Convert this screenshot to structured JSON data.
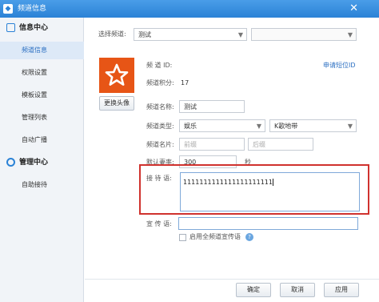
{
  "window": {
    "title": "频道信息",
    "close_glyph": "✕"
  },
  "sidebar": {
    "section1": {
      "label": "信息中心",
      "icon": "document-icon"
    },
    "section1_items": [
      {
        "label": "频道信息",
        "active": true
      },
      {
        "label": "权限设置",
        "active": false
      },
      {
        "label": "模板设置",
        "active": false
      },
      {
        "label": "管理列表",
        "active": false
      },
      {
        "label": "自动广播",
        "active": false
      }
    ],
    "section2": {
      "label": "管理中心",
      "icon": "gear-icon"
    },
    "section2_items": [
      {
        "label": "自助接待",
        "active": false
      }
    ]
  },
  "channel_select": {
    "label": "选择频道:",
    "value": "测试",
    "second_value": ""
  },
  "profile": {
    "id_label": "频 道 ID:",
    "id_value": "",
    "points_label": "频道积分:",
    "points_value": "17",
    "apply_link": "申请短位ID",
    "change_avatar": "更换头像"
  },
  "form": {
    "name_label": "频道名称:",
    "name_value": "测试",
    "type_label": "频道类型:",
    "type_value": "娱乐",
    "subtype_value": "K歌地带",
    "card_label": "频道名片:",
    "card_placeholder1": "前缀",
    "card_placeholder2": "后缀",
    "rate_label": "默认妻率:",
    "rate_value": "300",
    "rate_unit": "秒",
    "reception_label": "接 待 语:",
    "reception_value": "1111111111111111111111",
    "promo_label": "宣 传 语:",
    "promo_value": "",
    "promo_all_label": "启用全频道宣传语",
    "promo_all_checked": false
  },
  "footer": {
    "ok": "确定",
    "cancel": "取消",
    "apply": "应用"
  },
  "colors": {
    "accent": "#2b82d6",
    "avatar_bg": "#e75516",
    "highlight_border": "#d0322e"
  }
}
